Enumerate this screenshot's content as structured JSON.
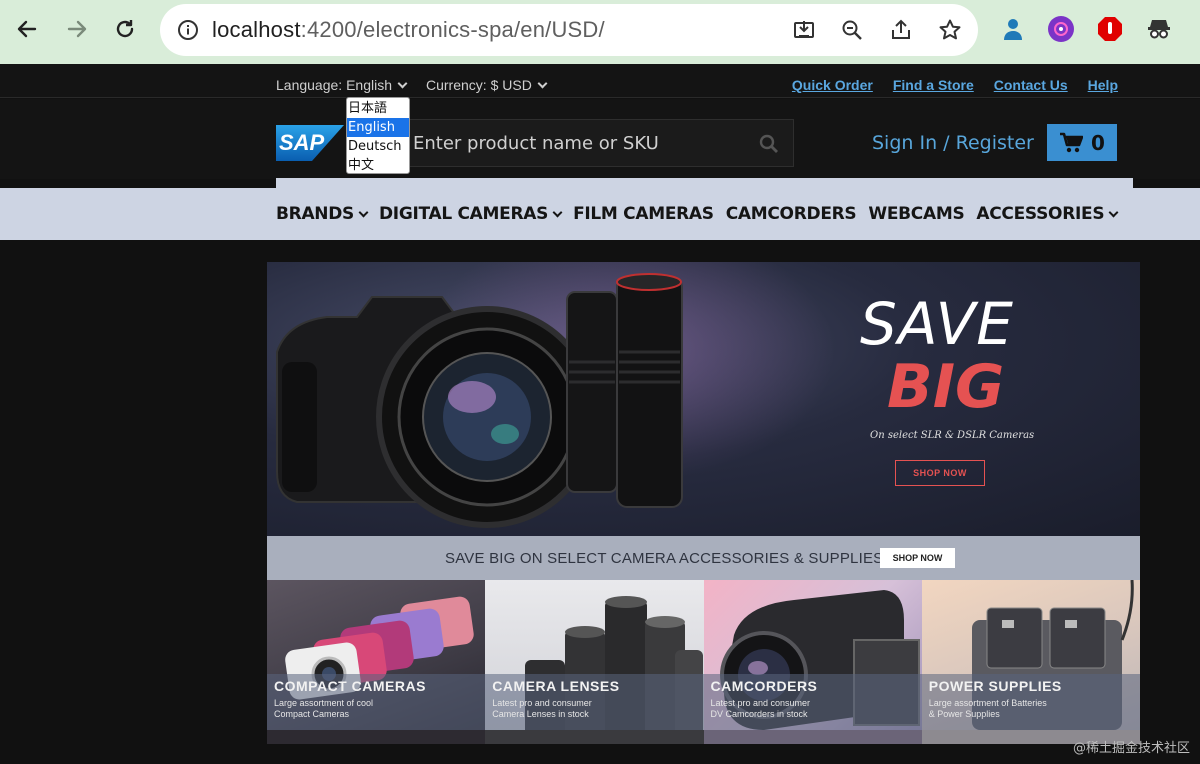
{
  "browser": {
    "url_host": "localhost",
    "url_path": ":4200/electronics-spa/en/USD/"
  },
  "topbar": {
    "language_label": "Language: English",
    "currency_label": "Currency: $ USD",
    "links": [
      "Quick Order",
      "Find a Store",
      "Contact Us",
      "Help"
    ]
  },
  "language_dropdown": {
    "options": [
      "日本語",
      "English",
      "Deutsch",
      "中文"
    ],
    "selected_index": 1
  },
  "header": {
    "logo_text": "SAP",
    "search_placeholder": "Enter product name or SKU",
    "signin_label": "Sign In / Register",
    "cart_count": "0"
  },
  "categories": [
    {
      "label": "BRANDS",
      "has_menu": true
    },
    {
      "label": "DIGITAL CAMERAS",
      "has_menu": true
    },
    {
      "label": "FILM CAMERAS",
      "has_menu": false
    },
    {
      "label": "CAMCORDERS",
      "has_menu": false
    },
    {
      "label": "WEBCAMS",
      "has_menu": false
    },
    {
      "label": "ACCESSORIES",
      "has_menu": true
    }
  ],
  "hero": {
    "headline_1": "SAVE",
    "headline_2": "BIG",
    "subtitle": "On select SLR & DSLR Cameras",
    "button": "SHOP NOW"
  },
  "strip": {
    "text": "SAVE BIG ON SELECT CAMERA ACCESSORIES & SUPPLIES",
    "button": "SHOP NOW"
  },
  "tiles": [
    {
      "title": "COMPACT CAMERAS",
      "desc_1": "Large assortment of cool",
      "desc_2": "Compact Cameras"
    },
    {
      "title": "CAMERA LENSES",
      "desc_1": "Latest pro and consumer",
      "desc_2": "Camera Lenses in stock"
    },
    {
      "title": "CAMCORDERS",
      "desc_1": "Latest pro and consumer",
      "desc_2": "DV Camcorders in stock"
    },
    {
      "title": "POWER SUPPLIES",
      "desc_1": "Large assortment of Batteries",
      "desc_2": "& Power Supplies"
    }
  ],
  "watermark": "@稀土掘金技术社区",
  "colors": {
    "accent_blue": "#3a8fd1",
    "link_blue": "#5aa7e0",
    "sale_red": "#e55252",
    "nav_bg": "#cdd4e3"
  }
}
